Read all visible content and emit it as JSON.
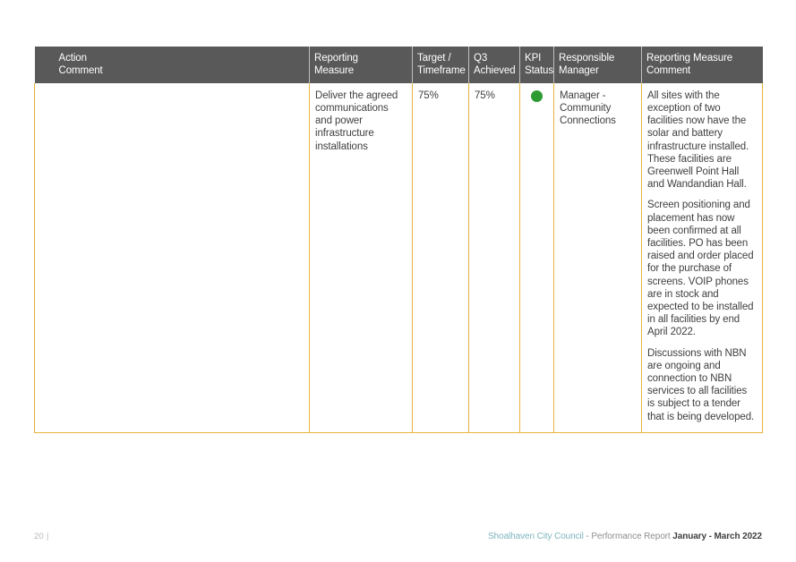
{
  "document": {
    "page_number": "20",
    "page_separator": "|"
  },
  "table": {
    "columns": [
      {
        "key": "action",
        "header_line1": "Action",
        "header_line2": "Comment"
      },
      {
        "key": "reporting_measure",
        "header_line1": "Reporting",
        "header_line2": "Measure"
      },
      {
        "key": "target_timeframe",
        "header_line1": "Target /",
        "header_line2": "Timeframe"
      },
      {
        "key": "q3_achieved",
        "header_line1": "Q3",
        "header_line2": "Achieved"
      },
      {
        "key": "kpi_status",
        "header_line1": "KPI",
        "header_line2": "Status"
      },
      {
        "key": "responsible_manager",
        "header_line1": "Responsible",
        "header_line2": "Manager"
      },
      {
        "key": "reporting_measure_comment",
        "header_line1": "Reporting Measure",
        "header_line2": "Comment"
      }
    ],
    "rows": [
      {
        "action": "",
        "reporting_measure": "Deliver the agreed communications and power infrastructure installations",
        "target_timeframe": "75%",
        "q3_achieved": "75%",
        "kpi_status": {
          "icon": "status-dot-green",
          "color": "#2E9B32",
          "label": "On track"
        },
        "responsible_manager": "Manager - Community Connections",
        "reporting_measure_comment": [
          "All sites with the exception of two facilities now have the solar and battery infrastructure installed. These facilities are Greenwell Point Hall and Wandandian Hall.",
          "Screen positioning and placement has now been confirmed at all facilities. PO has been raised and order placed for the purchase of screens. VOIP phones are in stock and expected to be installed in all facilities by end April 2022.",
          "Discussions with NBN are ongoing and connection to NBN services to all facilities is subject to a tender that is being developed."
        ]
      }
    ]
  },
  "footer": {
    "organisation": "Shoalhaven City Council",
    "separator_report": " - Performance Report ",
    "period": "January - March 2022"
  },
  "colors": {
    "header_background": "#595959",
    "table_border": "#E8B33C",
    "status_green": "#2E9B32",
    "footer_accent": "#7fb5bd"
  }
}
